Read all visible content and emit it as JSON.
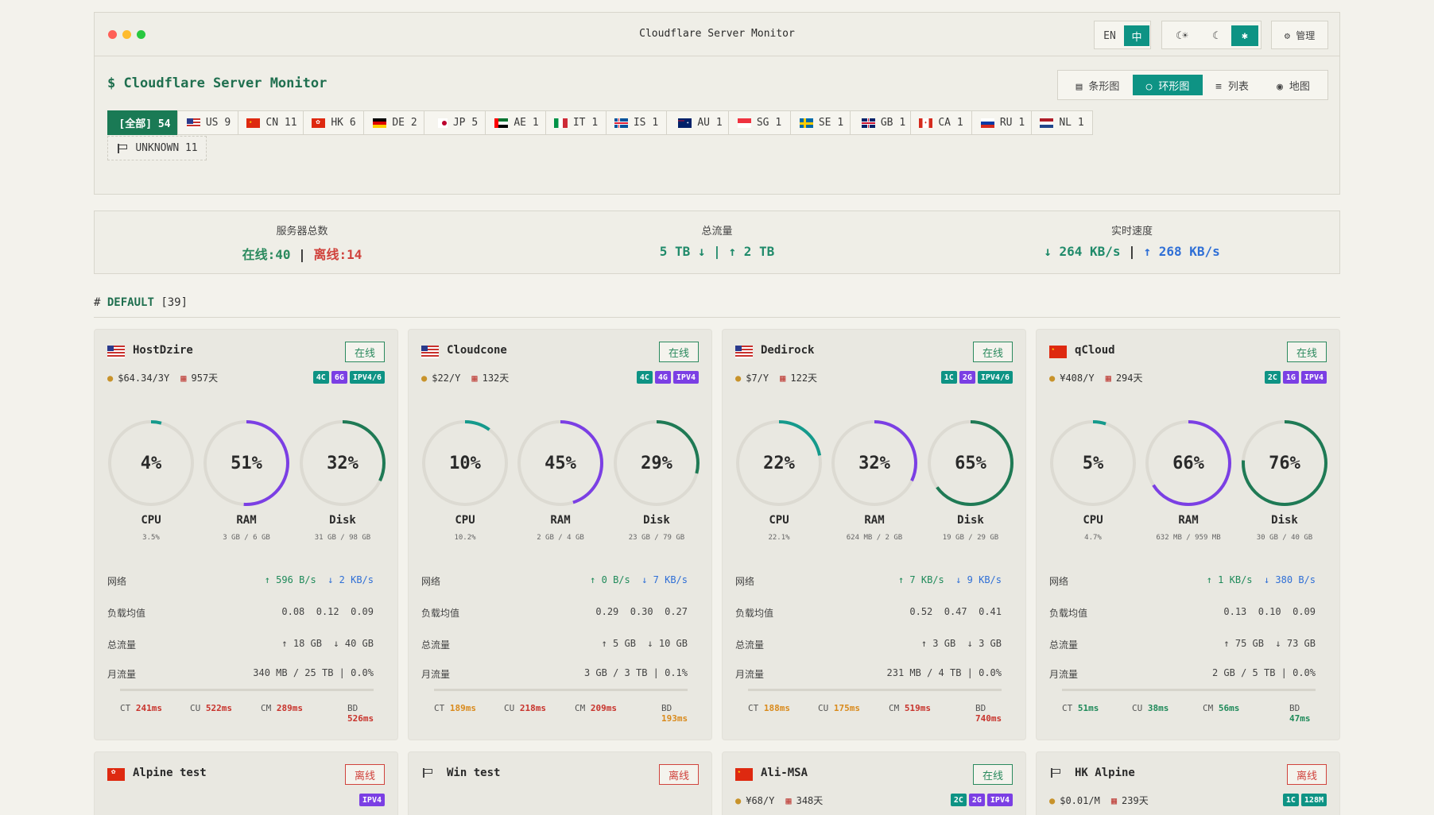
{
  "window": {
    "title": "Cloudflare Server Monitor",
    "lang": [
      "EN",
      "中"
    ],
    "theme_icons": [
      "moon-sun-icon",
      "moon-icon",
      "sun-icon"
    ],
    "admin_label": "⚙ 管理"
  },
  "header": {
    "app_title": "$ Cloudflare Server Monitor",
    "views": [
      "▤ 条形图",
      "○ 环形图",
      "≡ 列表",
      "◉ 地图"
    ],
    "active_view": 1
  },
  "filters": [
    {
      "label": "[全部] 54",
      "flag": "",
      "active": true
    },
    {
      "label": "US 9",
      "flag": "us"
    },
    {
      "label": "CN 11",
      "flag": "cn"
    },
    {
      "label": "HK 6",
      "flag": "hk"
    },
    {
      "label": "DE 2",
      "flag": "de"
    },
    {
      "label": "JP 5",
      "flag": "jp"
    },
    {
      "label": "AE 1",
      "flag": "ae"
    },
    {
      "label": "IT 1",
      "flag": "it"
    },
    {
      "label": "IS 1",
      "flag": "is"
    },
    {
      "label": "AU 1",
      "flag": "au"
    },
    {
      "label": "SG 1",
      "flag": "sg"
    },
    {
      "label": "SE 1",
      "flag": "se"
    },
    {
      "label": "GB 1",
      "flag": "gb"
    },
    {
      "label": "CA 1",
      "flag": "ca"
    },
    {
      "label": "RU 1",
      "flag": "ru"
    },
    {
      "label": "NL 1",
      "flag": "nl"
    },
    {
      "label": "UNKNOWN 11",
      "flag": "unknown"
    }
  ],
  "stats": {
    "servers_title": "服务器总数",
    "online": "在线:40",
    "sep": "|",
    "offline": "离线:14",
    "traffic_title": "总流量",
    "traffic": "5 TB ↓ | ↑ 2 TB",
    "speed_title": "实时速度",
    "down": "↓ 264 KB/s",
    "sep2": "|",
    "up": "↑ 268 KB/s"
  },
  "section": {
    "hash": "#",
    "name": "DEFAULT",
    "count": "[39]"
  },
  "labels": {
    "net": "网络",
    "load": "负载均值",
    "total": "总流量",
    "month": "月流量",
    "cpu": "CPU",
    "ram": "RAM",
    "disk": "Disk"
  },
  "cards": [
    {
      "name": "HostDzire",
      "flag": "us",
      "status": "在线",
      "online": true,
      "price": "$64.34/3Y",
      "days": "957天",
      "badges": [
        [
          "4C",
          "#0e9384"
        ],
        [
          "6G",
          "#7b3fe4"
        ],
        [
          "IPV4/6",
          "#0e9384"
        ]
      ],
      "cpu": "4%",
      "cpu_v": 4,
      "cpu_sub": "3.5%",
      "ram": "51%",
      "ram_v": 51,
      "ram_sub": "3 GB / 6 GB",
      "disk": "32%",
      "disk_v": 32,
      "disk_sub": "31 GB / 98 GB",
      "net_up": "↑ 596 B/s",
      "net_down": "↓ 2 KB/s",
      "load": [
        "0.08",
        "0.12",
        "0.09"
      ],
      "tot_up": "↑ 18 GB",
      "tot_down": "↓ 40 GB",
      "month": "340 MB / 25 TB | 0.0%",
      "pings": [
        [
          "CT",
          "241ms",
          "#c8332c"
        ],
        [
          "CU",
          "522ms",
          "#c8332c"
        ],
        [
          "CM",
          "289ms",
          "#c8332c"
        ],
        [
          "BD",
          "526ms",
          "#c8332c"
        ]
      ]
    },
    {
      "name": "Cloudcone",
      "flag": "us",
      "status": "在线",
      "online": true,
      "price": "$22/Y",
      "days": "132天",
      "badges": [
        [
          "4C",
          "#0e9384"
        ],
        [
          "4G",
          "#7b3fe4"
        ],
        [
          "IPV4",
          "#7b3fe4"
        ]
      ],
      "cpu": "10%",
      "cpu_v": 10,
      "cpu_sub": "10.2%",
      "ram": "45%",
      "ram_v": 45,
      "ram_sub": "2 GB / 4 GB",
      "disk": "29%",
      "disk_v": 29,
      "disk_sub": "23 GB / 79 GB",
      "net_up": "↑ 0 B/s",
      "net_down": "↓ 7 KB/s",
      "load": [
        "0.29",
        "0.30",
        "0.27"
      ],
      "tot_up": "↑ 5 GB",
      "tot_down": "↓ 10 GB",
      "month": "3 GB / 3 TB | 0.1%",
      "pings": [
        [
          "CT",
          "189ms",
          "#d98a1c"
        ],
        [
          "CU",
          "218ms",
          "#c8332c"
        ],
        [
          "CM",
          "209ms",
          "#c8332c"
        ],
        [
          "BD",
          "193ms",
          "#d98a1c"
        ]
      ]
    },
    {
      "name": "Dedirock",
      "flag": "us",
      "status": "在线",
      "online": true,
      "price": "$7/Y",
      "days": "122天",
      "badges": [
        [
          "1C",
          "#0e9384"
        ],
        [
          "2G",
          "#7b3fe4"
        ],
        [
          "IPV4/6",
          "#0e9384"
        ]
      ],
      "cpu": "22%",
      "cpu_v": 22,
      "cpu_sub": "22.1%",
      "ram": "32%",
      "ram_v": 32,
      "ram_sub": "624 MB / 2 GB",
      "disk": "65%",
      "disk_v": 65,
      "disk_sub": "19 GB / 29 GB",
      "net_up": "↑ 7 KB/s",
      "net_down": "↓ 9 KB/s",
      "load": [
        "0.52",
        "0.47",
        "0.41"
      ],
      "tot_up": "↑ 3 GB",
      "tot_down": "↓ 3 GB",
      "month": "231 MB / 4 TB | 0.0%",
      "pings": [
        [
          "CT",
          "188ms",
          "#d98a1c"
        ],
        [
          "CU",
          "175ms",
          "#d98a1c"
        ],
        [
          "CM",
          "519ms",
          "#c8332c"
        ],
        [
          "BD",
          "740ms",
          "#c8332c"
        ]
      ]
    },
    {
      "name": "qCloud",
      "flag": "cn",
      "status": "在线",
      "online": true,
      "price": "¥408/Y",
      "days": "294天",
      "badges": [
        [
          "2C",
          "#0e9384"
        ],
        [
          "1G",
          "#7b3fe4"
        ],
        [
          "IPV4",
          "#7b3fe4"
        ]
      ],
      "cpu": "5%",
      "cpu_v": 5,
      "cpu_sub": "4.7%",
      "ram": "66%",
      "ram_v": 66,
      "ram_sub": "632 MB / 959 MB",
      "disk": "76%",
      "disk_v": 76,
      "disk_sub": "30 GB / 40 GB",
      "net_up": "↑ 1 KB/s",
      "net_down": "↓ 380 B/s",
      "load": [
        "0.13",
        "0.10",
        "0.09"
      ],
      "tot_up": "↑ 75 GB",
      "tot_down": "↓ 73 GB",
      "month": "2 GB / 5 TB | 0.0%",
      "pings": [
        [
          "CT",
          "51ms",
          "#1f8a5a"
        ],
        [
          "CU",
          "38ms",
          "#1f8a5a"
        ],
        [
          "CM",
          "56ms",
          "#1f8a5a"
        ],
        [
          "BD",
          "47ms",
          "#1f8a5a"
        ]
      ]
    }
  ],
  "cards2": [
    {
      "name": "Alpine test",
      "flag": "hk",
      "status": "离线",
      "online": false,
      "price": "",
      "days": "",
      "badges": [
        [
          "IPV4",
          "#7b3fe4"
        ]
      ]
    },
    {
      "name": "Win test",
      "flag": "unknown",
      "status": "离线",
      "online": false,
      "price": "",
      "days": "",
      "badges": []
    },
    {
      "name": "Ali-MSA",
      "flag": "cn",
      "status": "在线",
      "online": true,
      "price": "¥68/Y",
      "days": "348天",
      "badges": [
        [
          "2C",
          "#0e9384"
        ],
        [
          "2G",
          "#7b3fe4"
        ],
        [
          "IPV4",
          "#7b3fe4"
        ]
      ]
    },
    {
      "name": "HK Alpine",
      "flag": "unknown",
      "status": "离线",
      "online": false,
      "price": "$0.01/M",
      "days": "239天",
      "badges": [
        [
          "1C",
          "#0e9384"
        ],
        [
          "128M",
          "#0e9384"
        ]
      ]
    }
  ],
  "colors": {
    "cpu": "#159a8c",
    "ram": "#7b3fe4",
    "disk": "#1f7a55",
    "track": "#dcdad2",
    "online": "#2b8a5e",
    "offline": "#d0433d"
  }
}
